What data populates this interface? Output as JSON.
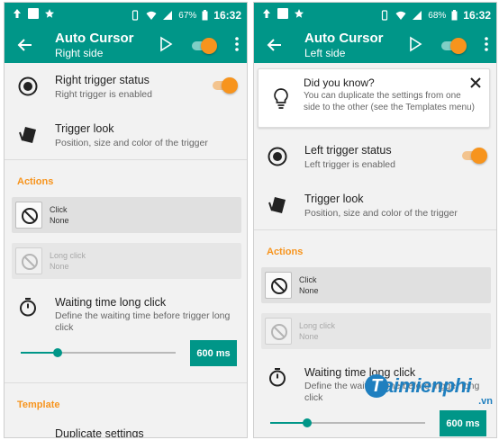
{
  "status_left": {
    "battery": "67%",
    "time": "16:32"
  },
  "status_right": {
    "battery": "68%",
    "time": "16:32"
  },
  "left": {
    "app_title": "Auto Cursor",
    "app_subtitle": "Right side",
    "trigger_status": {
      "title": "Right trigger status",
      "sub": "Right trigger is enabled"
    },
    "trigger_look": {
      "title": "Trigger look",
      "sub": "Position, size and color of the trigger"
    },
    "actions_label": "Actions",
    "click": {
      "title": "Click",
      "sub": "None"
    },
    "long_click": {
      "title": "Long click",
      "sub": "None"
    },
    "waiting": {
      "title": "Waiting time long click",
      "sub": "Define the waiting time before trigger long click"
    },
    "waiting_value": "600 ms",
    "slider_fraction": 0.24,
    "template_label": "Template",
    "duplicate": "Duplicate settings"
  },
  "right": {
    "app_title": "Auto Cursor",
    "app_subtitle": "Left side",
    "tip": {
      "title": "Did you know?",
      "body": "You can duplicate the settings from one side to the other (see the Templates menu)"
    },
    "trigger_status": {
      "title": "Left trigger status",
      "sub": "Left trigger is enabled"
    },
    "trigger_look": {
      "title": "Trigger look",
      "sub": "Position, size and color of the trigger"
    },
    "actions_label": "Actions",
    "click": {
      "title": "Click",
      "sub": "None"
    },
    "long_click": {
      "title": "Long click",
      "sub": "None"
    },
    "waiting": {
      "title": "Waiting time long click",
      "sub": "Define the waiting time before trigger long click"
    },
    "waiting_value": "600 ms",
    "slider_fraction": 0.24
  },
  "watermark": {
    "text": "aimienphi",
    "badge": "T",
    "suffix": ".vn"
  },
  "colors": {
    "primary": "#009688",
    "accent": "#f7941d"
  },
  "icons": [
    "back-arrow-icon",
    "play-icon",
    "overflow-menu-icon",
    "radio-target-icon",
    "trigger-look-icon",
    "block-icon",
    "timer-icon",
    "lightbulb-icon",
    "close-icon"
  ]
}
